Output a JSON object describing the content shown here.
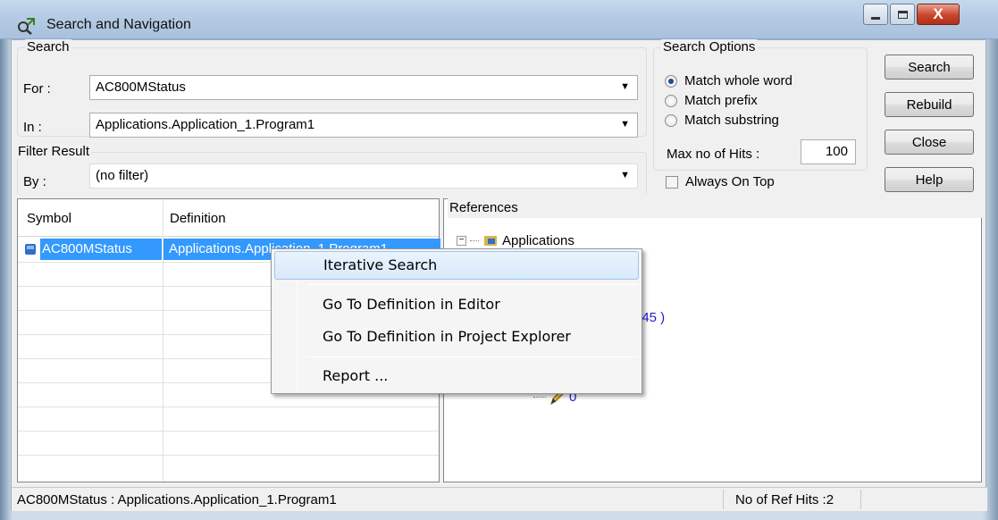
{
  "window": {
    "title": "Search and Navigation",
    "caption_close": "X"
  },
  "search_group": {
    "label": "Search",
    "for_label": "For :",
    "for_value": "AC800MStatus",
    "in_label": "In :",
    "in_value": "Applications.Application_1.Program1"
  },
  "filter_group": {
    "label": "Filter Result",
    "by_label": "By :",
    "by_value": "(no filter)"
  },
  "search_options": {
    "label": "Search Options",
    "options": [
      {
        "label": "Match whole word",
        "checked": true
      },
      {
        "label": "Match prefix",
        "checked": false
      },
      {
        "label": "Match substring",
        "checked": false
      }
    ],
    "max_hits_label": "Max no of Hits :",
    "max_hits_value": "100",
    "always_on_top_label": "Always On Top"
  },
  "buttons": {
    "search": "Search",
    "rebuild": "Rebuild",
    "close": "Close",
    "help": "Help"
  },
  "results_grid": {
    "columns": [
      "Symbol",
      "Definition"
    ],
    "rows": [
      {
        "symbol": "AC800MStatus",
        "definition": "Applications.Application_1.Program1"
      }
    ]
  },
  "references": {
    "label": "References",
    "tree_root": "Applications",
    "partial_coord": ", 45 )",
    "partial_value": "0"
  },
  "context_menu": {
    "items": [
      "Iterative Search",
      "Go To Definition in Editor",
      "Go To Definition in Project Explorer",
      "Report ..."
    ]
  },
  "status_bar": {
    "left_text": "AC800MStatus : Applications.Application_1.Program1",
    "ref_hits": "No of Ref Hits :2"
  }
}
